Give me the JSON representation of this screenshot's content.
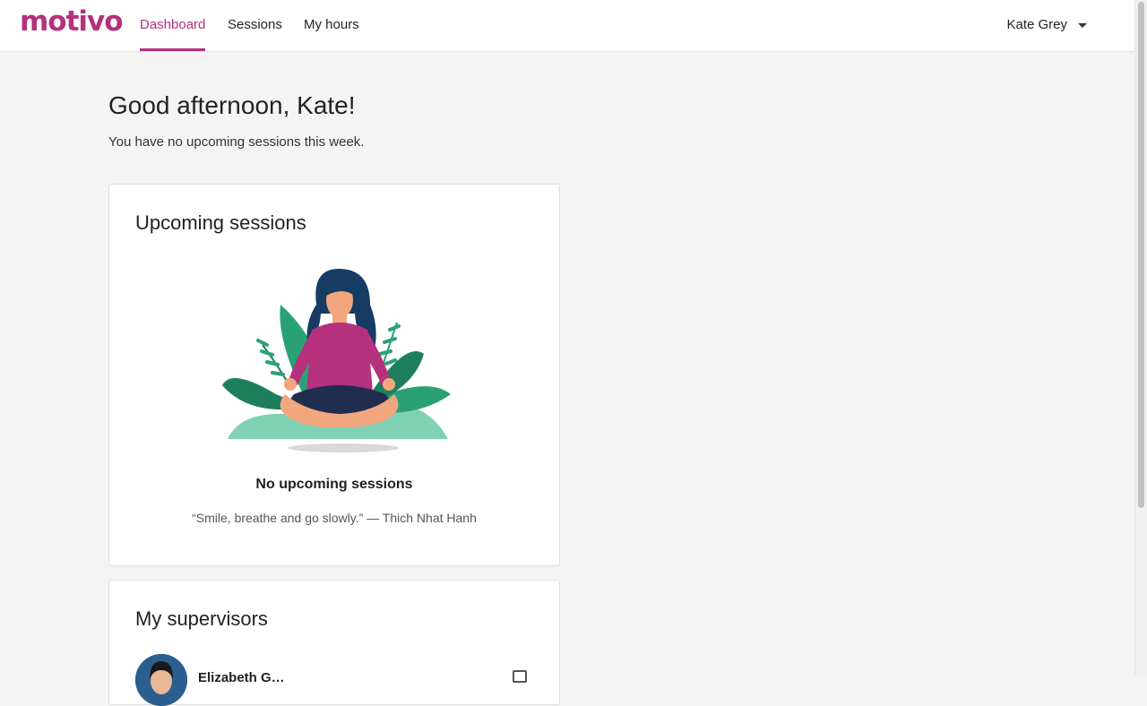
{
  "app": {
    "logo_text": "motivo",
    "brand_color": "#b5317d"
  },
  "nav": {
    "items": [
      {
        "label": "Dashboard",
        "active": true
      },
      {
        "label": "Sessions",
        "active": false
      },
      {
        "label": "My hours",
        "active": false
      }
    ],
    "user_name": "Kate Grey",
    "user_menu_icon": "caret-down-icon"
  },
  "main": {
    "greeting": "Good afternoon, Kate!",
    "subtext": "You have no upcoming sessions this week."
  },
  "upcoming": {
    "title": "Upcoming sessions",
    "illustration": "meditation-illustration",
    "empty_title": "No upcoming sessions",
    "quote": "“Smile, breathe and go slowly.” — Thich Nhat Hanh"
  },
  "supervisors": {
    "title": "My supervisors",
    "items": [
      {
        "name": "Elizabeth G…",
        "message_icon": "message-icon"
      }
    ]
  }
}
